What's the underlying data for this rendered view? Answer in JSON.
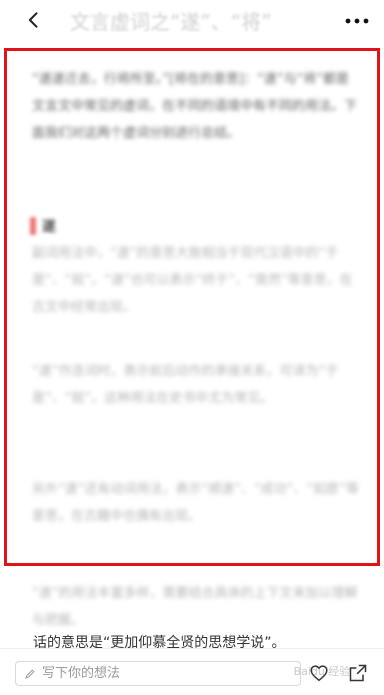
{
  "header": {
    "title": "文言虚词之“遂”、“将”"
  },
  "content": {
    "intro": "“遂遂迁去，行将所至。”[将在的意思]：“遂”与“将”都是文言文中常见的虚词，在不同的语境中有不同的用法。下面我们对这两个虚词分别进行总结。",
    "section_title": "遂",
    "paragraph_1": "副词用法中，“遂”的意思大致相当于现代汉语中的“于是”、“就”。“遂”也可以表示“终于”、“竟然”等意思，在古文中经常出现。",
    "paragraph_2": "“遂”作连词时，表示前后动作的承接关系，可译为“于是”、“就”。这种用法在史书中尤为常见。",
    "paragraph_3": "另外“遂”还有动词用法，表示“顺遂”、“成功”、“如愿”等意思，在古籍中也偶有出现。",
    "paragraph_4": "“遂”的用法丰富多样，需要结合具体的上下文来加以理解与把握。"
  },
  "quote_line": "话的意思是“更加仰慕全贤的思想学说”。",
  "bottom_bar": {
    "comment_placeholder": "写下你的想法"
  },
  "watermark": "Baidu 经验",
  "colors": {
    "highlight_border": "#e0131a",
    "section_mark": "#f07373"
  }
}
